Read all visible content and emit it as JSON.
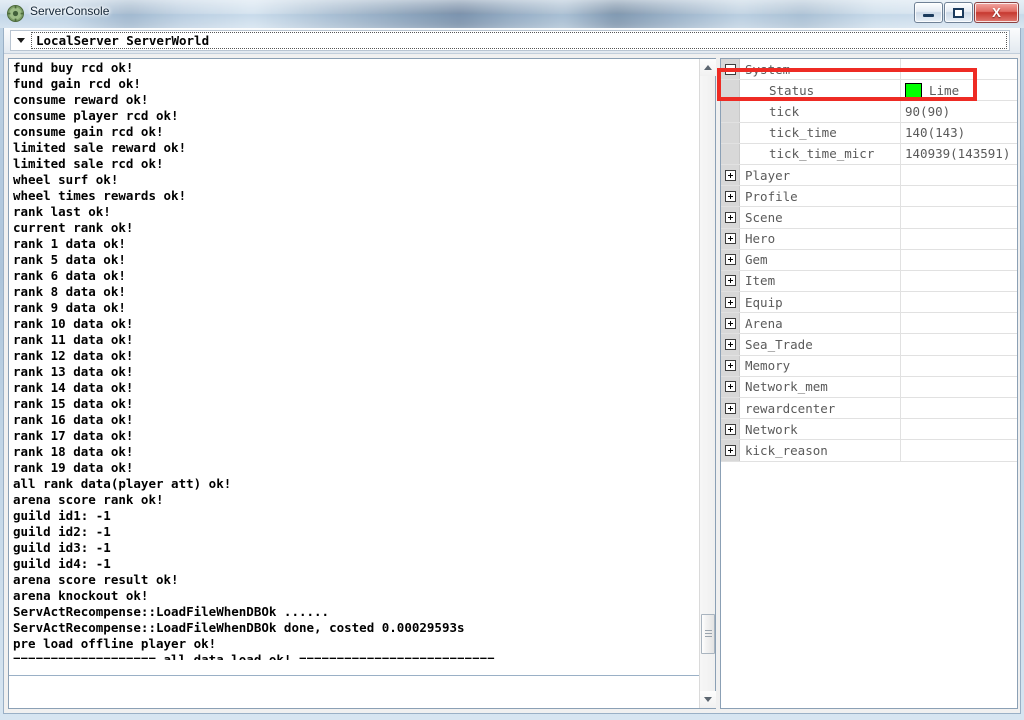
{
  "window": {
    "title": "ServerConsole",
    "app_icon": "gear-icon",
    "controls": {
      "minimize_label": "Minimize",
      "maximize_label": "Maximize",
      "close_label": "X"
    }
  },
  "toolbar": {
    "server_selector_value": "LocalServer ServerWorld",
    "dropdown_icon": "chevron-down-icon"
  },
  "log": {
    "lines": [
      "fund buy rcd ok!",
      "fund gain rcd ok!",
      "consume reward ok!",
      "consume player rcd ok!",
      "consume gain rcd ok!",
      "limited sale reward ok!",
      "limited sale rcd ok!",
      "wheel surf ok!",
      "wheel times rewards ok!",
      "rank last ok!",
      "current rank ok!",
      "rank 1 data ok!",
      "rank 5 data ok!",
      "rank 6 data ok!",
      "rank 8 data ok!",
      "rank 9 data ok!",
      "rank 10 data ok!",
      "rank 11 data ok!",
      "rank 12 data ok!",
      "rank 13 data ok!",
      "rank 14 data ok!",
      "rank 15 data ok!",
      "rank 16 data ok!",
      "rank 17 data ok!",
      "rank 18 data ok!",
      "rank 19 data ok!",
      "all rank data(player att) ok!",
      "arena score rank ok!",
      "guild id1: -1",
      "guild id2: -1",
      "guild id3: -1",
      "guild id4: -1",
      "arena score result ok!",
      "arena knockout ok!",
      "ServActRecompense::LoadFileWhenDBOk ......",
      "ServActRecompense::LoadFileWhenDBOk done, costed 0.00029593s",
      "pre load offline player ok!",
      "=================== all data load ok! =========================="
    ]
  },
  "tree": {
    "rows": [
      {
        "expander": "minus",
        "name": "System",
        "value": "",
        "child": false
      },
      {
        "expander": "none",
        "name": "Status",
        "value": "Lime",
        "child": true,
        "swatch": "#00FF00"
      },
      {
        "expander": "none",
        "name": "tick",
        "value": "90(90)",
        "child": true
      },
      {
        "expander": "none",
        "name": "tick_time",
        "value": "140(143)",
        "child": true
      },
      {
        "expander": "none",
        "name": "tick_time_micr",
        "value": "140939(143591)",
        "child": true
      },
      {
        "expander": "plus",
        "name": "Player",
        "value": "",
        "child": false
      },
      {
        "expander": "plus",
        "name": "Profile",
        "value": "",
        "child": false
      },
      {
        "expander": "plus",
        "name": "Scene",
        "value": "",
        "child": false
      },
      {
        "expander": "plus",
        "name": "Hero",
        "value": "",
        "child": false
      },
      {
        "expander": "plus",
        "name": "Gem",
        "value": "",
        "child": false
      },
      {
        "expander": "plus",
        "name": "Item",
        "value": "",
        "child": false
      },
      {
        "expander": "plus",
        "name": "Equip",
        "value": "",
        "child": false
      },
      {
        "expander": "plus",
        "name": "Arena",
        "value": "",
        "child": false
      },
      {
        "expander": "plus",
        "name": "Sea_Trade",
        "value": "",
        "child": false
      },
      {
        "expander": "plus",
        "name": "Memory",
        "value": "",
        "child": false
      },
      {
        "expander": "plus",
        "name": "Network_mem",
        "value": "",
        "child": false
      },
      {
        "expander": "plus",
        "name": "rewardcenter",
        "value": "",
        "child": false
      },
      {
        "expander": "plus",
        "name": "Network",
        "value": "",
        "child": false
      },
      {
        "expander": "plus",
        "name": "kick_reason",
        "value": "",
        "child": false
      }
    ]
  },
  "annotation": {
    "color": "#ee2b24",
    "target": "Status row"
  }
}
